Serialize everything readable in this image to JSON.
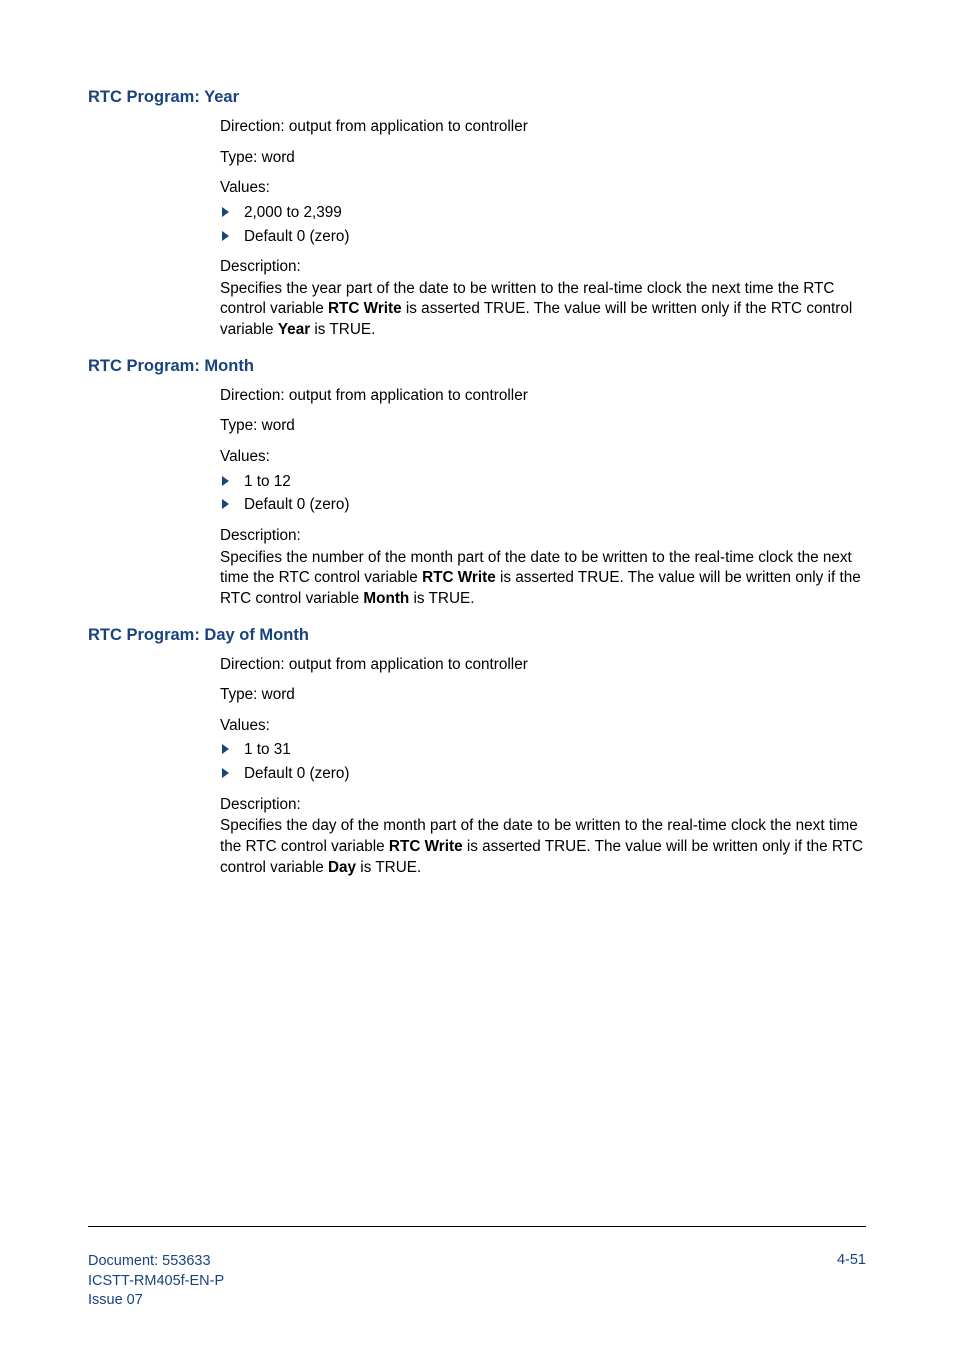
{
  "sections": [
    {
      "heading": "RTC Program: Year",
      "direction": "Direction: output from application to controller",
      "type": "Type: word",
      "valuesLabel": "Values:",
      "values": [
        "2,000 to 2,399",
        "Default 0 (zero)"
      ],
      "descLabel": "Description:",
      "descPre": "Specifies the year part of the date to be written to the real-time clock the next time the RTC control variable ",
      "descBold1": "RTC Write",
      "descMid": " is asserted TRUE. The value will be written only if the RTC control variable ",
      "descBold2": "Year",
      "descPost": " is TRUE."
    },
    {
      "heading": "RTC Program: Month",
      "direction": "Direction: output from application to controller",
      "type": "Type: word",
      "valuesLabel": "Values:",
      "values": [
        "1 to 12",
        "Default 0 (zero)"
      ],
      "descLabel": "Description:",
      "descPre": "Specifies the number of the month part of the date to be written to the real-time clock the next time the RTC control variable ",
      "descBold1": "RTC Write",
      "descMid": " is asserted TRUE. The value will be written only if the RTC control variable ",
      "descBold2": "Month",
      "descPost": " is TRUE."
    },
    {
      "heading": "RTC Program: Day of Month",
      "direction": "Direction: output from application to controller",
      "type": "Type: word",
      "valuesLabel": "Values:",
      "values": [
        "1 to 31",
        "Default 0 (zero)"
      ],
      "descLabel": "Description:",
      "descPre": "Specifies the day of the month part of the date to be written to the real-time clock the next time the RTC control variable ",
      "descBold1": "RTC Write",
      "descMid": " is asserted TRUE. The value will be written only if the RTC control variable ",
      "descBold2": "Day",
      "descPost": " is TRUE."
    }
  ],
  "footer": {
    "doc": "Document: 553633",
    "ref": "ICSTT-RM405f-EN-P",
    "issue": " Issue 07",
    "pageNum": "4-51"
  }
}
